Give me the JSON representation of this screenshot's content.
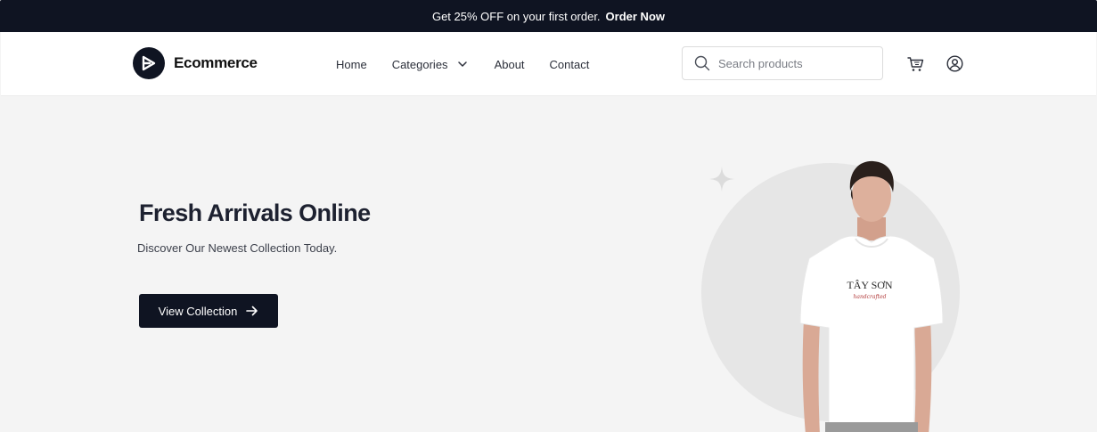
{
  "promo": {
    "text": "Get 25% OFF on your first order.",
    "link": "Order Now"
  },
  "header": {
    "logo_text": "Ecommerce",
    "nav": {
      "home": "Home",
      "categories": "Categories",
      "about": "About",
      "contact": "Contact"
    },
    "search_placeholder": "Search products"
  },
  "hero": {
    "title": "Fresh Arrivals Online",
    "subtitle": "Discover Our Newest Collection Today.",
    "cta_label": "View Collection",
    "tshirt_brand": "TÂY SƠN",
    "tshirt_script": "handcrafted"
  },
  "icons": {
    "search": "search-icon",
    "cart": "cart-icon",
    "account": "user-icon",
    "chevron": "chevron-down-icon",
    "arrow": "arrow-right-icon",
    "sparkle": "sparkle-icon"
  },
  "colors": {
    "dark": "#0f1422",
    "hero_bg": "#f4f4f4",
    "circle": "#e6e6e6"
  }
}
